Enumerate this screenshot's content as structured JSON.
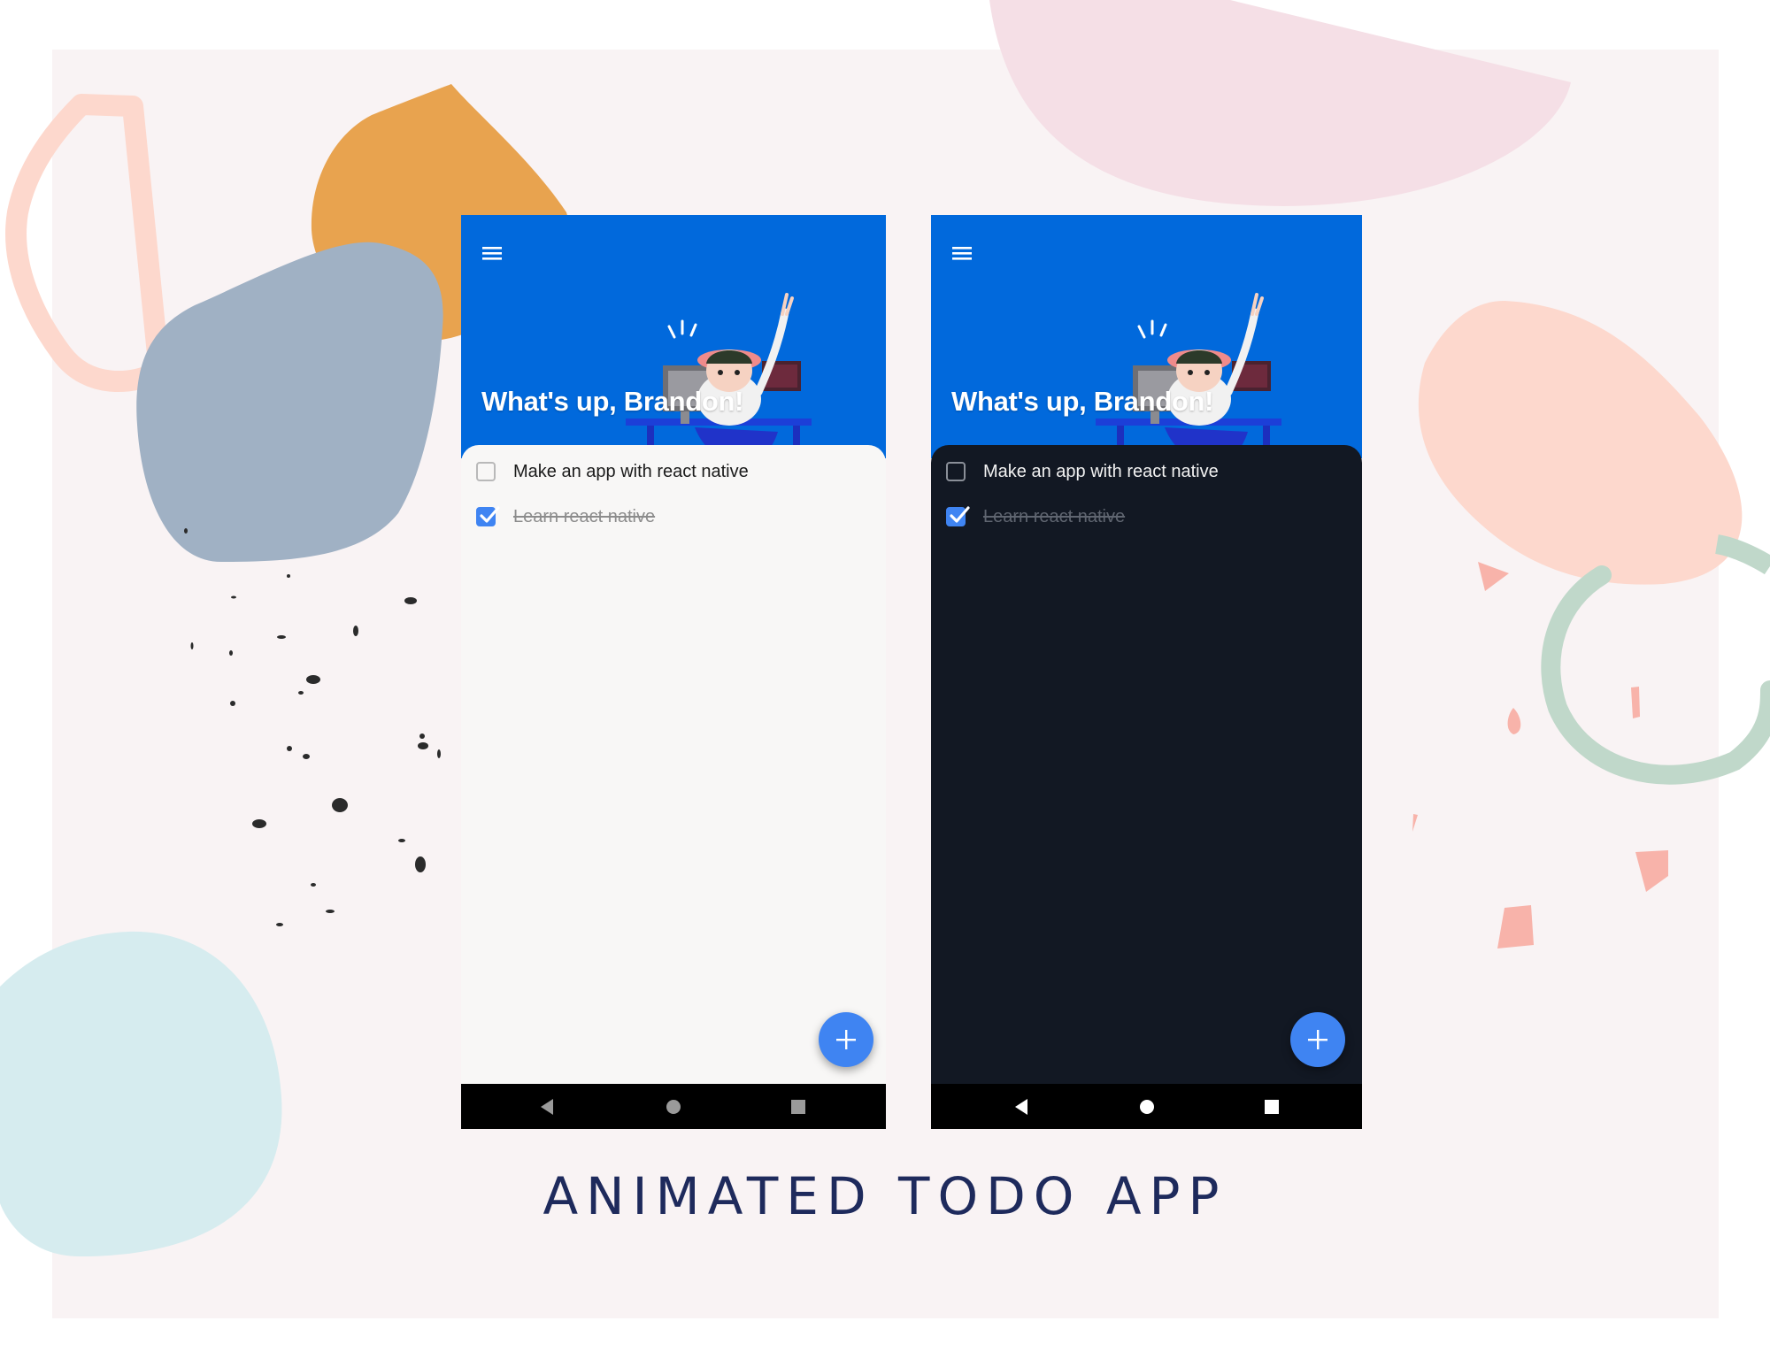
{
  "app_title": "ANIMATED TODO APP",
  "screens": [
    {
      "theme": "light",
      "greeting": "What's up, Brandon!",
      "tasks": [
        {
          "label": "Make an app with react native",
          "done": false
        },
        {
          "label": "Learn react native",
          "done": true
        }
      ]
    },
    {
      "theme": "dark",
      "greeting": "What's up, Brandon!",
      "tasks": [
        {
          "label": "Make an app with react native",
          "done": false
        },
        {
          "label": "Learn react native",
          "done": true
        }
      ]
    }
  ],
  "icons": {
    "menu": "hamburger-menu-icon",
    "fab": "plus-icon",
    "nav": [
      "back-triangle-icon",
      "home-circle-icon",
      "recents-square-icon"
    ]
  },
  "colors": {
    "header_blue": "#0169dc",
    "accent_blue": "#3f84f2",
    "dark_background": "#121823",
    "light_background": "#f8f7f6",
    "title_navy": "#1e2a5c"
  }
}
